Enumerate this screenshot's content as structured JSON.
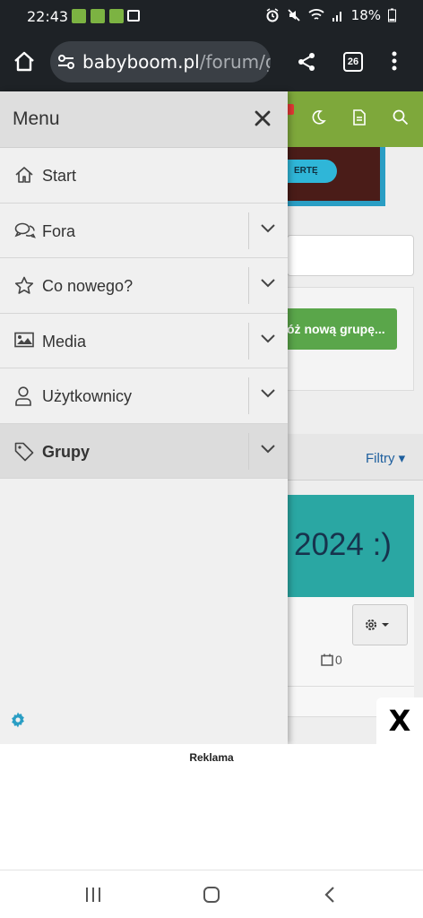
{
  "status_bar": {
    "time": "22:43",
    "battery": "18%"
  },
  "browser": {
    "url_host": "babyboom.pl",
    "url_path": "/forum/gi",
    "tab_count": "26"
  },
  "page": {
    "banner_button": "ERTĘ",
    "create_group_button": "óż nową grupę...",
    "filter_label": "Filtry",
    "group_title": "2024 :)",
    "calendar_count": "0"
  },
  "menu": {
    "title": "Menu",
    "items": [
      {
        "label": "Start",
        "icon": "home-icon"
      },
      {
        "label": "Fora",
        "icon": "comments-icon"
      },
      {
        "label": "Co nowego?",
        "icon": "star-icon"
      },
      {
        "label": "Media",
        "icon": "image-icon"
      },
      {
        "label": "Użytkownicy",
        "icon": "user-icon"
      },
      {
        "label": "Grupy",
        "icon": "tag-icon",
        "active": true
      }
    ]
  },
  "ad": {
    "label": "Reklama",
    "close": "X"
  },
  "colors": {
    "brand_green": "#7ea83b",
    "teal": "#2aa7a3",
    "gear_blue": "#2a9ec4"
  }
}
